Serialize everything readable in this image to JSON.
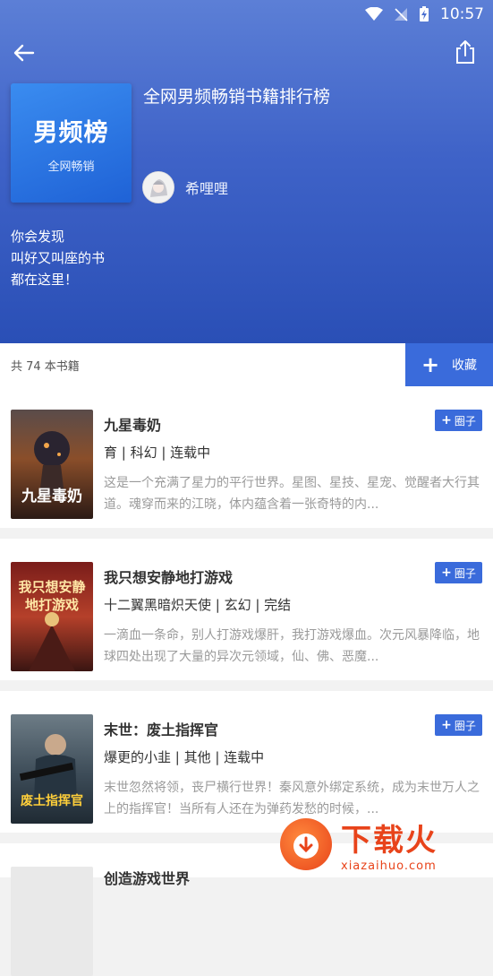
{
  "status": {
    "time": "10:57"
  },
  "header": {
    "cover_title": "男频榜",
    "cover_subtitle": "全网畅销",
    "list_title": "全网男频畅销书籍排行榜",
    "author": "希哩哩",
    "description": [
      "你会发现",
      "叫好又叫座的书",
      "都在这里！"
    ]
  },
  "count_bar": {
    "count_text": "共 74 本书籍",
    "collect_label": "收藏"
  },
  "books": [
    {
      "title": "九星毒奶",
      "meta": "育 | 科幻 | 连载中",
      "summary": "这是一个充满了星力的平行世界。星图、星技、星宠、觉醒者大行其道。魂穿而来的江晓，体内蕴含着一张奇特的内...",
      "button": "圈子",
      "cover_text": "九星毒奶"
    },
    {
      "title": "我只想安静地打游戏",
      "meta": "十二翼黑暗炽天使 | 玄幻 | 完结",
      "summary": "一滴血一条命，别人打游戏爆肝，我打游戏爆血。次元风暴降临，地球四处出现了大量的异次元领域，仙、佛、恶魔...",
      "button": "圈子",
      "cover_text": "我只想安静地打游戏"
    },
    {
      "title": "末世：废土指挥官",
      "meta": "爆更的小韭 | 其他 | 连载中",
      "summary": "末世忽然将领，丧尸横行世界！秦风意外绑定系统，成为末世万人之上的指挥官！当所有人还在为弹药发愁的时候，...",
      "button": "圈子",
      "cover_text": "废土指挥官"
    },
    {
      "title": "创造游戏世界",
      "meta": "",
      "summary": "",
      "button": "",
      "cover_text": ""
    }
  ],
  "watermark": {
    "main": "下载火",
    "url": "xiazaihuo.com"
  },
  "colors": {
    "accent": "#3a6bdb",
    "header_top": "#5c7fd6",
    "header_bottom": "#2a4fb6"
  }
}
